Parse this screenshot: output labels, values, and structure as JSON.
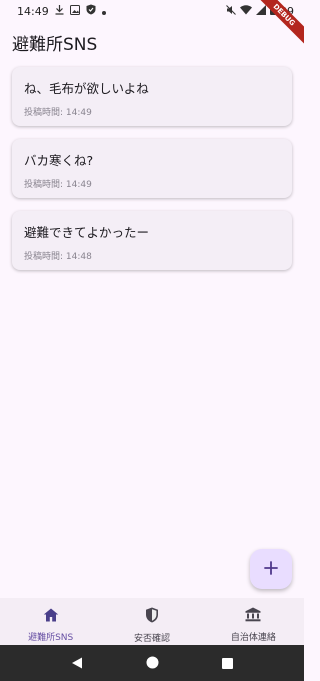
{
  "status_bar": {
    "time": "14:49",
    "battery": "89"
  },
  "debug_banner": "DEBUG",
  "app_bar": {
    "title": "避難所SNS"
  },
  "posts": [
    {
      "text": "ね、毛布が欲しいよね",
      "time": "投稿時間: 14:49"
    },
    {
      "text": "バカ寒くね?",
      "time": "投稿時間: 14:49"
    },
    {
      "text": "避難できてよかったー",
      "time": "投稿時間: 14:48"
    }
  ],
  "fab": {
    "icon": "plus-icon"
  },
  "bottom_nav": {
    "items": [
      {
        "label": "避難所SNS",
        "icon": "home-icon",
        "active": true
      },
      {
        "label": "安否確認",
        "icon": "shield-icon",
        "active": false
      },
      {
        "label": "自治体連絡",
        "icon": "institution-icon",
        "active": false
      }
    ]
  },
  "colors": {
    "background": "#fdf6fe",
    "card": "#f4eef6",
    "accent": "#6750a4",
    "fab": "#e9ddff"
  }
}
